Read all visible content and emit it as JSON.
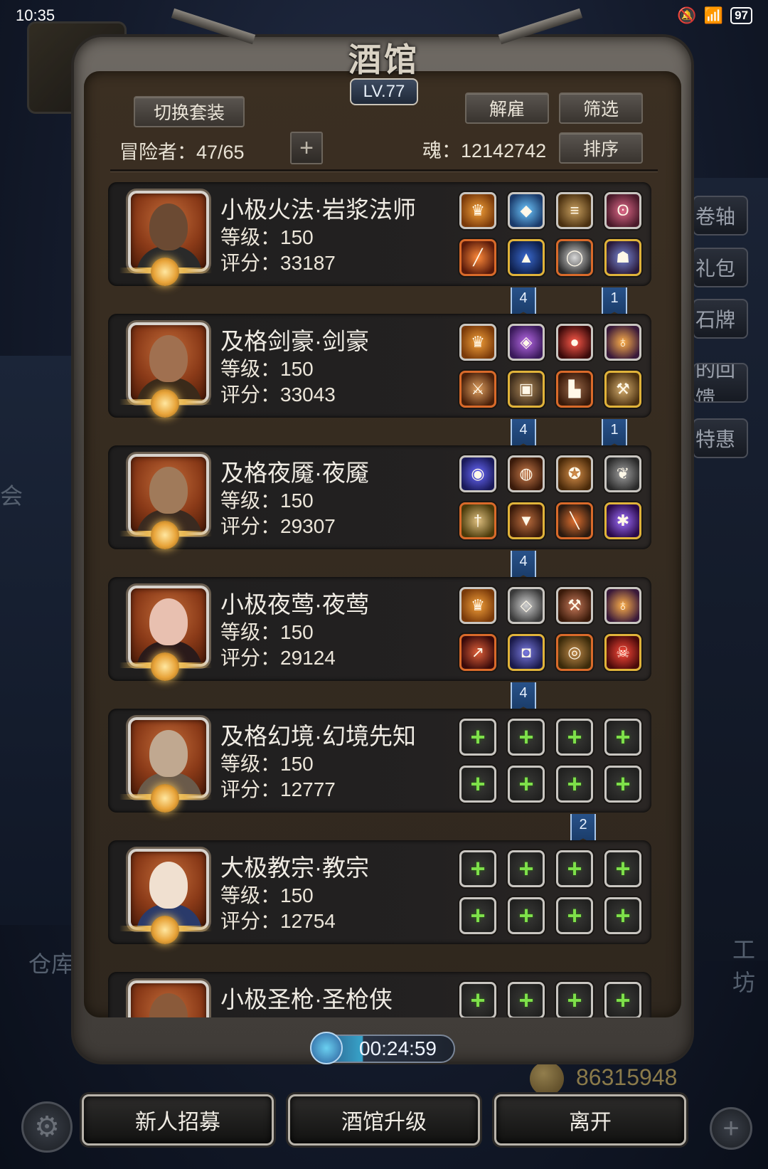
{
  "status_bar": {
    "time": "10:35",
    "battery": "97"
  },
  "panel": {
    "title": "酒馆",
    "level": "LV.77",
    "switch_outfit": "切换套装",
    "dismiss": "解雇",
    "filter": "筛选",
    "sort": "排序",
    "adventurers": "冒险者：47/65",
    "souls": "魂：12142742"
  },
  "heroes": [
    {
      "name": "小极火法·岩浆法师",
      "level": "等级：150",
      "score": "评分：33187",
      "slots": [
        "crown-icon",
        "crystal-icon",
        "scroll-icon",
        "necklace-icon",
        "staff-icon",
        "cloak-icon",
        "ring-icon",
        "dragon-helm-icon"
      ],
      "ribbons": [
        "4",
        "1"
      ]
    },
    {
      "name": "及格剑豪·剑豪",
      "level": "等级：150",
      "score": "评分：33043",
      "slots": [
        "crown-icon",
        "gem-icon",
        "ruby-icon",
        "lantern-icon",
        "sword-icon",
        "armor-icon",
        "boots-icon",
        "axe-icon"
      ],
      "ribbons": [
        "4",
        "1"
      ]
    },
    {
      "name": "及格夜魇·夜魇",
      "level": "等级：150",
      "score": "评分：29307",
      "slots": [
        "orb-icon",
        "ore-icon",
        "medallion-icon",
        "feather-icon",
        "dagger-icon",
        "robe-icon",
        "blade-icon",
        "spider-icon"
      ],
      "ribbons": [
        "4"
      ]
    },
    {
      "name": "小极夜莺·夜莺",
      "level": "等级：150",
      "score": "评分：29124",
      "slots": [
        "crown-icon",
        "stone-icon",
        "hammer-icon",
        "lantern-icon",
        "spear-icon",
        "plate-armor-icon",
        "bracer-icon",
        "demon-mask-icon"
      ],
      "ribbons": [
        "4"
      ]
    },
    {
      "name": "及格幻境·幻境先知",
      "level": "等级：150",
      "score": "评分：12777",
      "slots": [
        "empty",
        "empty",
        "empty",
        "empty",
        "empty",
        "empty",
        "empty",
        "empty"
      ],
      "ribbons": [
        "2"
      ]
    },
    {
      "name": "大极教宗·教宗",
      "level": "等级：150",
      "score": "评分：12754",
      "slots": [
        "empty",
        "empty",
        "empty",
        "empty",
        "empty",
        "empty",
        "empty",
        "empty"
      ],
      "ribbons": []
    },
    {
      "name": "小极圣枪·圣枪侠",
      "level": "",
      "score": "",
      "slots": [
        "empty",
        "empty",
        "empty",
        "empty"
      ],
      "ribbons": []
    }
  ],
  "timer": "00:24:59",
  "bottom_buttons": {
    "recruit": "新人招募",
    "upgrade": "酒馆升级",
    "leave": "离开"
  },
  "background": {
    "side_buttons": [
      "卷轴",
      "礼包",
      "石牌",
      "的回馈",
      "特惠"
    ],
    "warehouse": "仓库",
    "workshop": "工坊",
    "meeting": "会",
    "gold": "86315948"
  },
  "colors": {
    "frame": "#5a5550",
    "panel": "#342a20",
    "accent_plus": "#7ee04a",
    "ribbon": "#28528a",
    "portrait_bg": "#a84a20"
  }
}
